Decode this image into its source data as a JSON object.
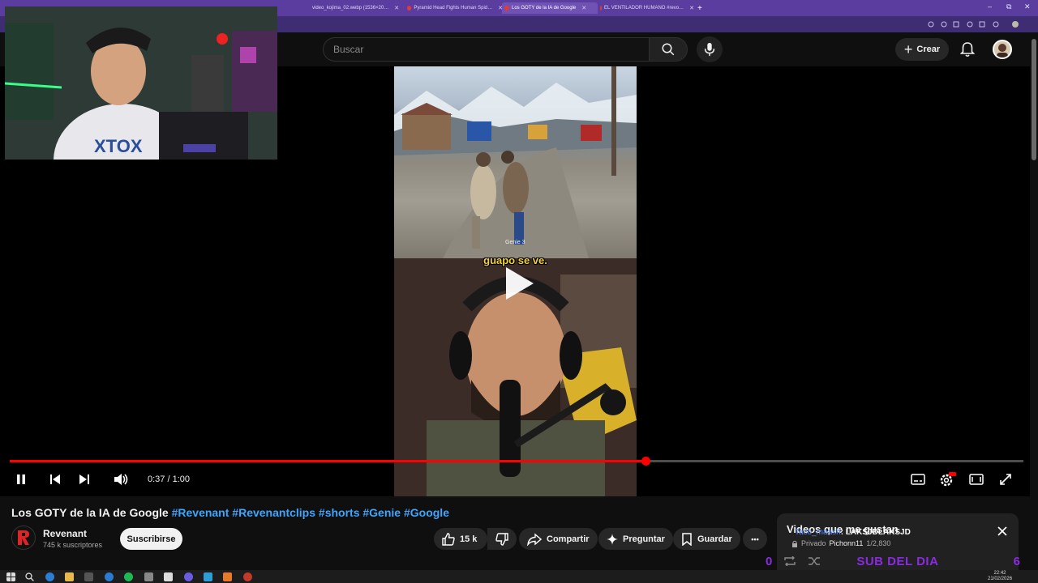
{
  "browser": {
    "tabs": [
      {
        "label": "video_kojima_02.webp (1536×20…"
      },
      {
        "label": "Pyramid Head Fights Human Spid…"
      },
      {
        "label": "Los GOTY de la IA de Google"
      },
      {
        "label": "EL VENTILADOR HUMANO #revo…"
      }
    ],
    "new_tab": "+",
    "window_controls": {
      "minimize": "–",
      "maximize": "⧉",
      "close": "✕"
    }
  },
  "header": {
    "search_placeholder": "Buscar",
    "create_label": "Crear"
  },
  "player": {
    "time": "0:37 / 1:00",
    "progress": 0.627,
    "caption": "guapo se ve.",
    "watermark": "Genie 3"
  },
  "video": {
    "title_prefix": "Los GOTY de la IA de Google",
    "hashtags": [
      "#Revenant",
      "#Revenantclips",
      "#shorts",
      "#Genie",
      "#Google"
    ]
  },
  "channel": {
    "name": "Revenant",
    "subscribers": "745 k suscriptores",
    "subscribe_label": "Suscribirse"
  },
  "actions": {
    "likes": "15 k",
    "share": "Compartir",
    "ask": "Preguntar",
    "save": "Guardar",
    "more": "•••"
  },
  "popup": {
    "title": "Videos que me gustan",
    "privacy": "Privado",
    "owner": "Pichonn11",
    "position": "1/2,830"
  },
  "chat": {
    "user": "Taco_maash",
    "message": ": LAKSJDLAKSJD"
  },
  "stream_overlay": {
    "left_count": "0",
    "label": "SUB DEL DIA",
    "right_count": "6"
  },
  "taskbar": {
    "time": "22:42",
    "date": "21/02/2026"
  },
  "colors": {
    "accent_red": "#ff0000",
    "hashtag_blue": "#3ea6ff",
    "browser_purple": "#5a3d9e",
    "overlay_purple": "#8a2be2"
  }
}
